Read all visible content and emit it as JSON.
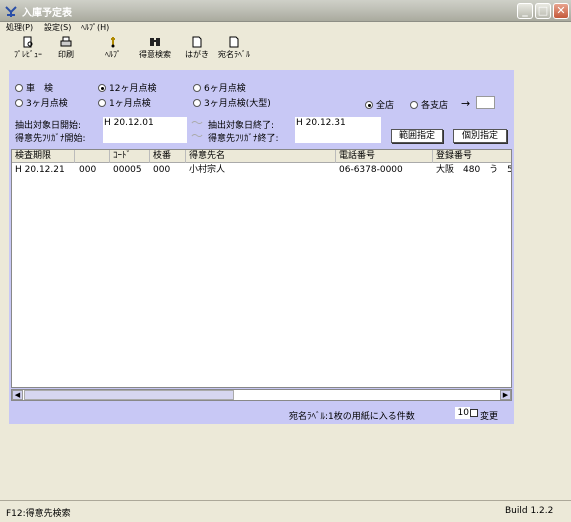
{
  "window": {
    "title": "入庫予定表"
  },
  "menu": {
    "items": [
      "処理(P)",
      "設定(S)",
      "ﾍﾙﾌﾟ(H)"
    ]
  },
  "toolbar": {
    "items": [
      {
        "label": "ﾌﾟﾚﾋﾞｭｰ",
        "icon": "preview-icon"
      },
      {
        "label": "印刷",
        "icon": "printer-icon"
      },
      {
        "label": "ﾍﾙﾌﾟ",
        "icon": "help-icon"
      },
      {
        "label": "得意検索",
        "icon": "binoculars-icon"
      },
      {
        "label": "はがき",
        "icon": "postcard-icon"
      },
      {
        "label": "宛名ﾗﾍﾞﾙ",
        "icon": "label-icon"
      }
    ]
  },
  "filters": {
    "inspection_types": [
      {
        "label": "車　検",
        "selected": false
      },
      {
        "label": "12ヶ月点検",
        "selected": true
      },
      {
        "label": "6ヶ月点検",
        "selected": false
      },
      {
        "label": "3ヶ月点検",
        "selected": false
      },
      {
        "label": "1ヶ月点検",
        "selected": false
      },
      {
        "label": "3ヶ月点検(大型)",
        "selected": false
      }
    ],
    "store": [
      {
        "label": "全店",
        "selected": true
      },
      {
        "label": "各支店",
        "selected": false
      }
    ],
    "arrow": "→",
    "date_start_label": "抽出対象日開始:",
    "date_start_value": "H 20.12.01",
    "date_end_label": "抽出対象日終了:",
    "date_end_value": "H 20.12.31",
    "kana_start_label": "得意先ﾌﾘｶﾞﾅ開始:",
    "kana_start_value": "",
    "kana_end_label": "得意先ﾌﾘｶﾞﾅ終了:",
    "kana_end_value": "",
    "tilde": "～",
    "range_button": "範囲指定",
    "individual_button": "個別指定"
  },
  "table": {
    "columns": [
      "検査期限",
      "",
      "ｺｰﾄﾞ",
      "枝番",
      "得意先名",
      "電話番号",
      "登録番号"
    ],
    "rows": [
      [
        "H 20.12.21",
        "000",
        "00005",
        "000",
        "小村宗人",
        "06-6378-0000",
        "大阪　480　う　5"
      ]
    ]
  },
  "label_setting": {
    "text": "宛名ﾗﾍﾞﾙ:1枚の用紙に入る件数",
    "count": "10",
    "change_label": "変更"
  },
  "status": {
    "left": "F12:得意先検索",
    "right": "Build 1.2.2"
  }
}
